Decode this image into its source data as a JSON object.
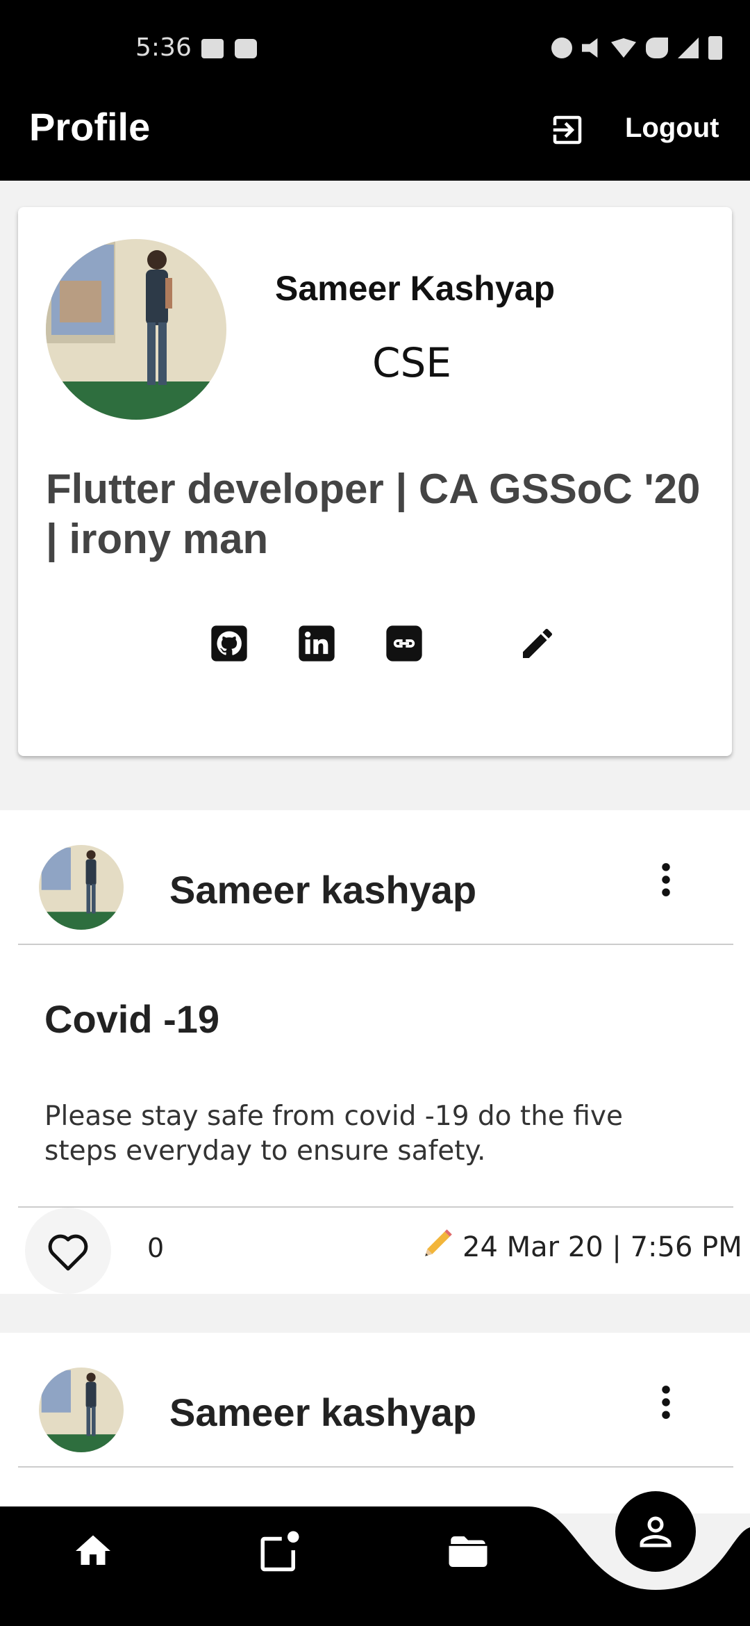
{
  "status_bar": {
    "time": "5:36"
  },
  "app_bar": {
    "title": "Profile",
    "logout_label": "Logout"
  },
  "profile": {
    "name": "Sameer Kashyap",
    "department": "CSE",
    "bio": "Flutter developer | CA GSSoC '20 | irony man",
    "links": [
      "github-icon",
      "linkedin-icon",
      "website-link-icon",
      "edit-icon"
    ]
  },
  "posts": [
    {
      "author": "Sameer kashyap",
      "title": "Covid -19",
      "body": "Please stay safe from covid -19 do the five steps everyday to ensure safety.",
      "likes": "0",
      "date": "24 Mar 20 | 7:56 PM"
    },
    {
      "author": "Sameer kashyap"
    }
  ],
  "bottom_nav": {
    "items": [
      "home-icon",
      "feed-icon",
      "folder-icon",
      "profile-icon"
    ],
    "active": "profile-icon"
  },
  "colors": {
    "bar": "#000000",
    "card": "#ffffff",
    "background": "#f2f2f2"
  }
}
